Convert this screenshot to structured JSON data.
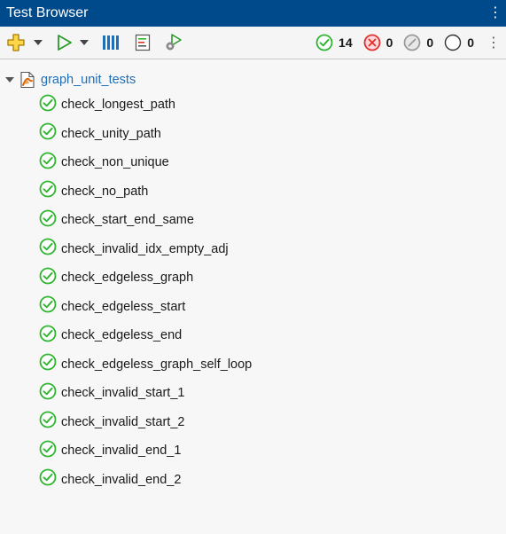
{
  "window": {
    "title": "Test Browser"
  },
  "toolbar": {
    "counts": {
      "passed": "14",
      "failed": "0",
      "incomplete": "0",
      "not_run": "0"
    },
    "colors": {
      "pass": "#2fb52f",
      "fail": "#e03030",
      "incomplete": "#9a9a9a",
      "not_run": "#333333"
    }
  },
  "suite": {
    "name": "graph_unit_tests",
    "tests": [
      {
        "name": "check_longest_path"
      },
      {
        "name": "check_unity_path"
      },
      {
        "name": "check_non_unique"
      },
      {
        "name": "check_no_path"
      },
      {
        "name": "check_start_end_same"
      },
      {
        "name": "check_invalid_idx_empty_adj"
      },
      {
        "name": "check_edgeless_graph"
      },
      {
        "name": "check_edgeless_start"
      },
      {
        "name": "check_edgeless_end"
      },
      {
        "name": "check_edgeless_graph_self_loop"
      },
      {
        "name": "check_invalid_start_1"
      },
      {
        "name": "check_invalid_start_2"
      },
      {
        "name": "check_invalid_end_1"
      },
      {
        "name": "check_invalid_end_2"
      }
    ]
  }
}
